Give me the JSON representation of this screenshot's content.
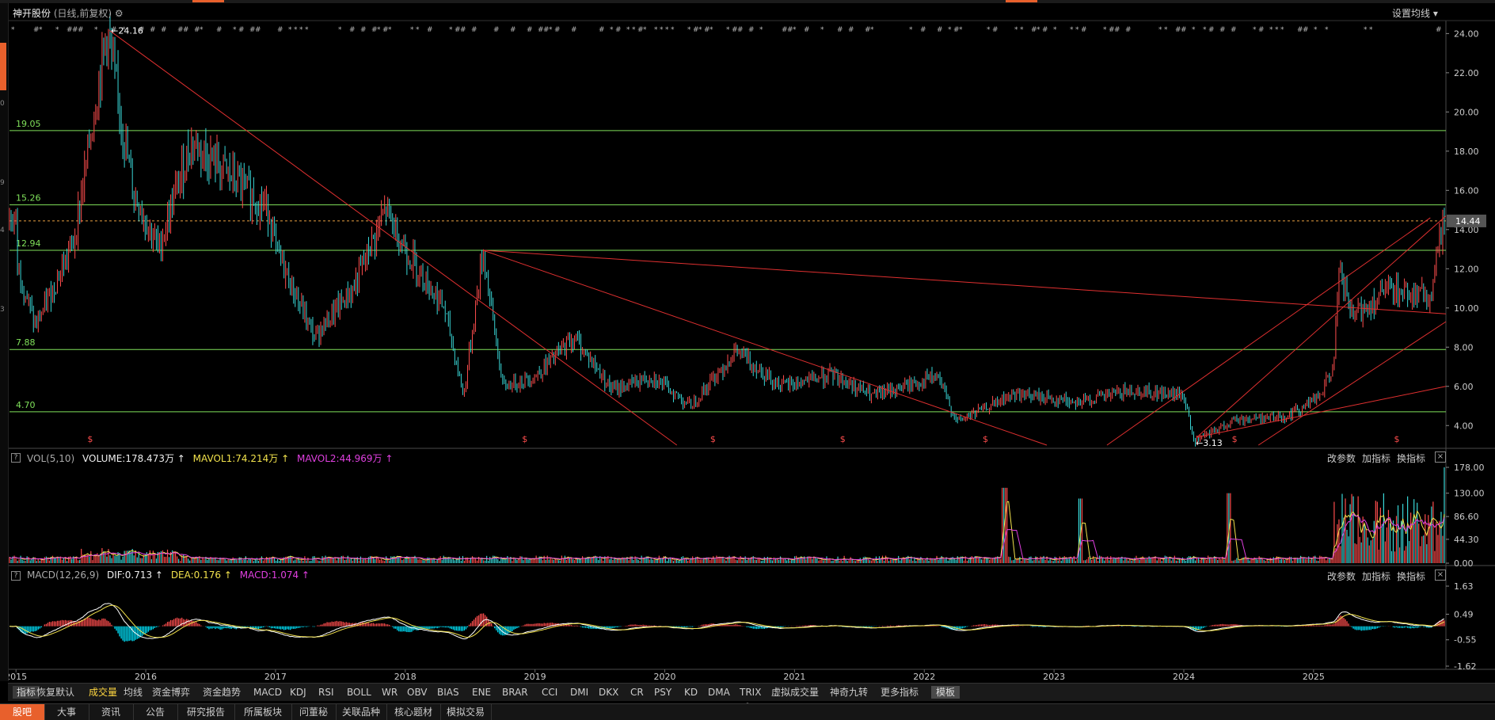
{
  "colors": {
    "up": "#ff4d4d",
    "down": "#39d6d6",
    "level_line": "#7fe05a",
    "trend_line": "#e03030",
    "ma_yellow": "#f2e24c",
    "ma_magenta": "#e040e0",
    "accent": "#e8602c"
  },
  "header": {
    "stock_name": "神开股份",
    "sub": "(日线,前复权)",
    "gear_icon": "gear-icon",
    "settings": "设置均线 ▾"
  },
  "main": {
    "y_ticks": [
      "24.00",
      "22.00",
      "20.00",
      "18.00",
      "16.00",
      "14.00",
      "12.00",
      "10.00",
      "8.00",
      "6.00",
      "4.00"
    ],
    "current_price": "14.44",
    "levels": [
      "19.05",
      "15.26",
      "12.94",
      "7.88",
      "4.70"
    ],
    "annot_high": "24.16",
    "annot_low": "3.13",
    "dollar_markers": [
      "$",
      "$",
      "$",
      "$",
      "$",
      "$",
      "$"
    ]
  },
  "x_axis": [
    "2015",
    "2016",
    "2017",
    "2018",
    "2019",
    "2020",
    "2021",
    "2022",
    "2023",
    "2024",
    "2025"
  ],
  "vol": {
    "label": "VOL(5,10)",
    "volume": "VOLUME:178.473万 ↑",
    "mavol1": "MAVOL1:74.214万 ↑",
    "mavol2": "MAVOL2:44.969万 ↑",
    "y_ticks": [
      "178.00",
      "130.00",
      "86.60",
      "44.30",
      "0.00"
    ],
    "buttons": [
      "改参数",
      "加指标",
      "换指标"
    ]
  },
  "macd": {
    "label": "MACD(12,26,9)",
    "dif": "DIF:0.713 ↑",
    "dea": "DEA:0.176 ↑",
    "macd": "MACD:1.074 ↑",
    "y_ticks": [
      "1.63",
      "0.49",
      "-0.55",
      "-1.62"
    ],
    "buttons": [
      "改参数",
      "加指标",
      "换指标"
    ]
  },
  "indicator_tabs": [
    "指标",
    "恢复默认",
    "成交量",
    "均线",
    "资金博弈",
    "资金趋势",
    "MACD",
    "KDJ",
    "RSI",
    "BOLL",
    "WR",
    "OBV",
    "BIAS",
    "ENE",
    "BRAR",
    "CCI",
    "DMI",
    "DKX",
    "CR",
    "PSY",
    "KD",
    "DMA",
    "TRIX",
    "虚拟成交量",
    "神奇九转",
    "更多指标",
    "模板"
  ],
  "bottom_tabs": [
    "股吧",
    "大事",
    "资讯",
    "公告",
    "研究报告",
    "所属板块",
    "问董秘",
    "关联品种",
    "核心题材",
    "模拟交易"
  ],
  "chart_data": {
    "type": "candlestick",
    "x": [
      "2015",
      "2016",
      "2017",
      "2018",
      "2019",
      "2020",
      "2021",
      "2022",
      "2023",
      "2024",
      "2025"
    ],
    "price_points": [
      [
        2015.0,
        12.5
      ],
      [
        2015.15,
        9.0
      ],
      [
        2015.45,
        13.5
      ],
      [
        2015.7,
        24.16
      ],
      [
        2015.9,
        16
      ],
      [
        2016.1,
        13
      ],
      [
        2016.35,
        18.5
      ],
      [
        2016.6,
        17
      ],
      [
        2016.95,
        15
      ],
      [
        2017.0,
        13
      ],
      [
        2017.3,
        8.5
      ],
      [
        2017.6,
        11
      ],
      [
        2017.85,
        15
      ],
      [
        2018.0,
        13
      ],
      [
        2018.3,
        10
      ],
      [
        2018.45,
        5.5
      ],
      [
        2018.6,
        12.94
      ],
      [
        2018.75,
        6
      ],
      [
        2019.0,
        6.5
      ],
      [
        2019.3,
        8.5
      ],
      [
        2019.6,
        5.8
      ],
      [
        2019.9,
        6.5
      ],
      [
        2020.2,
        5
      ],
      [
        2020.55,
        7.8
      ],
      [
        2020.9,
        6
      ],
      [
        2021.3,
        6.6
      ],
      [
        2021.6,
        5.5
      ],
      [
        2022.1,
        6.5
      ],
      [
        2022.25,
        4.2
      ],
      [
        2022.7,
        5.6
      ],
      [
        2023.2,
        5.2
      ],
      [
        2023.6,
        5.8
      ],
      [
        2024.0,
        5.5
      ],
      [
        2024.08,
        3.13
      ],
      [
        2024.4,
        4.3
      ],
      [
        2024.8,
        4.5
      ],
      [
        2025.05,
        5.5
      ],
      [
        2025.15,
        7
      ],
      [
        2025.2,
        11.8
      ],
      [
        2025.3,
        9.5
      ],
      [
        2025.6,
        11
      ],
      [
        2025.9,
        10.5
      ],
      [
        2026.0,
        14.44
      ]
    ],
    "ylim": [
      3.0,
      24.5
    ],
    "vol_ylim": [
      0,
      178
    ],
    "macd_ylim": [
      -1.62,
      1.63
    ]
  }
}
